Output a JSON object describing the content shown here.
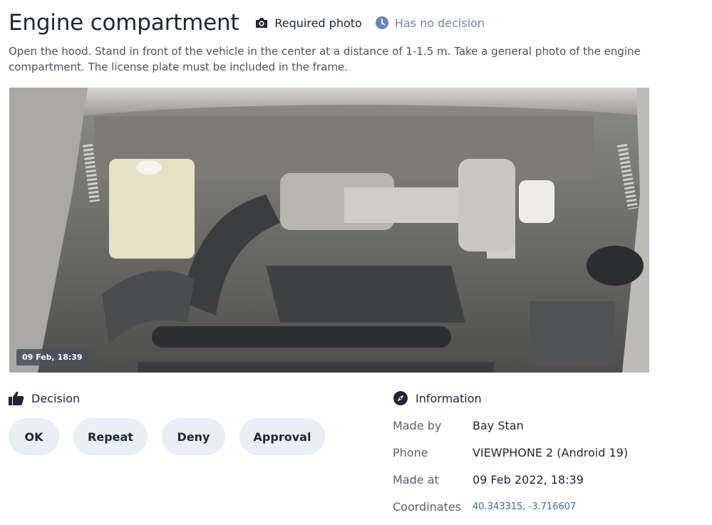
{
  "header": {
    "title": "Engine compartment",
    "required_label": "Required photo",
    "status_label": "Has no decision"
  },
  "description": "Open the hood. Stand in front of the vehicle in the center at a distance of 1-1.5 m. Take a general photo of the engine compartment. The license plate must be included in the frame.",
  "photo": {
    "timestamp": "09 Feb, 18:39"
  },
  "decision": {
    "heading": "Decision",
    "buttons": [
      "OK",
      "Repeat",
      "Deny",
      "Approval"
    ]
  },
  "information": {
    "heading": "Information",
    "rows": [
      {
        "label": "Made by",
        "value": "Bay Stan"
      },
      {
        "label": "Phone",
        "value": "VIEWPHONE 2 (Android 19)"
      },
      {
        "label": "Made at",
        "value": "09 Feb 2022, 18:39"
      },
      {
        "label": "Coordinates",
        "value": "40.343315, -3.716607"
      }
    ]
  },
  "colors": {
    "status": "#6a86b3",
    "button_bg": "#e9eff6",
    "link": "#3b6aa6",
    "title": "#1e2733"
  }
}
